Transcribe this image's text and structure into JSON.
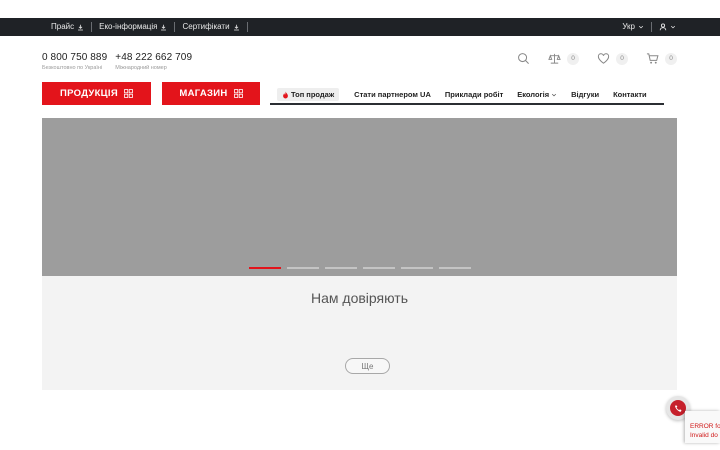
{
  "topbar": {
    "links": [
      {
        "label": "Прайс"
      },
      {
        "label": "Еко-інформація"
      },
      {
        "label": "Сертифікати"
      }
    ],
    "language": "Укр"
  },
  "contacts": [
    {
      "number": "0 800 750 889",
      "note": "Безкоштовно по Україні"
    },
    {
      "number": "+48 222 662 709",
      "note": "Міжнародний номер"
    }
  ],
  "header_icons": {
    "compare_count": "0",
    "wishlist_count": "0",
    "cart_count": "0"
  },
  "buttons": {
    "products": "ПРОДУКЦІЯ",
    "shop": "МАГАЗИН"
  },
  "nav": [
    {
      "label": "Топ продаж"
    },
    {
      "label": "Стати партнером UA"
    },
    {
      "label": "Приклади робіт"
    },
    {
      "label": "Екологія"
    },
    {
      "label": "Відгуки"
    },
    {
      "label": "Контакти"
    }
  ],
  "slider": {
    "slide_count": 6,
    "active_index": 0
  },
  "trust": {
    "heading": "Нам довіряють",
    "more_label": "Ще"
  },
  "recaptcha": {
    "line1": "ERROR fo",
    "line2": "Invalid do"
  },
  "colors": {
    "accent": "#e3141b",
    "topbar": "#1f2226",
    "slider": "#9d9d9d",
    "section_bg": "#f3f3f3"
  }
}
